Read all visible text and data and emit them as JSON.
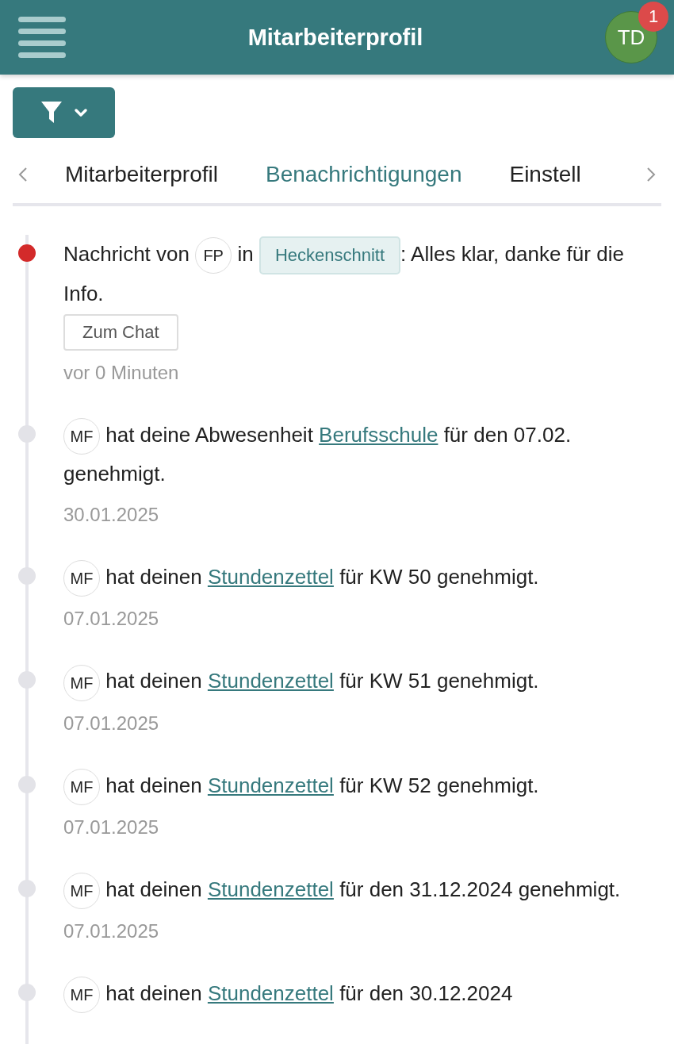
{
  "header": {
    "title": "Mitarbeiterprofil",
    "avatar": "TD",
    "badge": "1"
  },
  "tabs": [
    {
      "label": "Mitarbeiterprofil",
      "selected": false
    },
    {
      "label": "Benachrichtigungen",
      "selected": true
    },
    {
      "label": "Einstell",
      "selected": false
    }
  ],
  "notifications": [
    {
      "unread": true,
      "parts": [
        {
          "kind": "text",
          "text": "Nachricht von "
        },
        {
          "kind": "avatar",
          "text": "FP"
        },
        {
          "kind": "text",
          "text": " in "
        },
        {
          "kind": "tag",
          "text": "Heckenschnitt"
        },
        {
          "kind": "text",
          "text": ": Alles klar, danke für die Info."
        }
      ],
      "button": "Zum Chat",
      "time": "vor 0 Minuten"
    },
    {
      "unread": false,
      "parts": [
        {
          "kind": "avatar",
          "text": "MF"
        },
        {
          "kind": "text",
          "text": " hat deine Abwesenheit "
        },
        {
          "kind": "link",
          "text": "Berufsschule"
        },
        {
          "kind": "text",
          "text": " für den 07.02. genehmigt."
        }
      ],
      "time": "30.01.2025"
    },
    {
      "unread": false,
      "parts": [
        {
          "kind": "avatar",
          "text": "MF"
        },
        {
          "kind": "text",
          "text": " hat deinen "
        },
        {
          "kind": "link",
          "text": "Stundenzettel"
        },
        {
          "kind": "text",
          "text": " für KW 50 genehmigt."
        }
      ],
      "time": "07.01.2025"
    },
    {
      "unread": false,
      "parts": [
        {
          "kind": "avatar",
          "text": "MF"
        },
        {
          "kind": "text",
          "text": " hat deinen "
        },
        {
          "kind": "link",
          "text": "Stundenzettel"
        },
        {
          "kind": "text",
          "text": " für KW 51 genehmigt."
        }
      ],
      "time": "07.01.2025"
    },
    {
      "unread": false,
      "parts": [
        {
          "kind": "avatar",
          "text": "MF"
        },
        {
          "kind": "text",
          "text": " hat deinen "
        },
        {
          "kind": "link",
          "text": "Stundenzettel"
        },
        {
          "kind": "text",
          "text": " für KW 52 genehmigt."
        }
      ],
      "time": "07.01.2025"
    },
    {
      "unread": false,
      "parts": [
        {
          "kind": "avatar",
          "text": "MF"
        },
        {
          "kind": "text",
          "text": " hat deinen "
        },
        {
          "kind": "link",
          "text": "Stundenzettel"
        },
        {
          "kind": "text",
          "text": " für den 31.12.2024 genehmigt."
        }
      ],
      "time": "07.01.2025"
    },
    {
      "unread": false,
      "parts": [
        {
          "kind": "avatar",
          "text": "MF"
        },
        {
          "kind": "text",
          "text": " hat deinen "
        },
        {
          "kind": "link",
          "text": "Stundenzettel"
        },
        {
          "kind": "text",
          "text": " für den 30.12.2024"
        }
      ]
    }
  ]
}
